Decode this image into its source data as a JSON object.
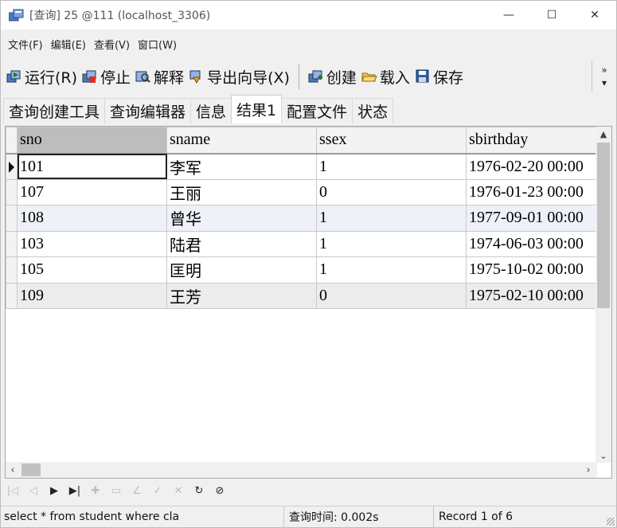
{
  "window": {
    "title": "[查询] 25 @111 (localhost_3306)",
    "controls": {
      "minimize": "—",
      "maximize": "☐",
      "close": "✕"
    }
  },
  "menu": [
    "文件(F)",
    "编辑(E)",
    "查看(V)",
    "窗口(W)"
  ],
  "toolbar": {
    "run": "运行(R)",
    "stop": "停止",
    "explain": "解释",
    "export": "导出向导(X)",
    "create": "创建",
    "load": "载入",
    "save": "保存",
    "overflow": "»"
  },
  "tabs": [
    "查询创建工具",
    "查询编辑器",
    "信息",
    "结果1",
    "配置文件",
    "状态"
  ],
  "active_tab": "结果1",
  "grid": {
    "columns": [
      "sno",
      "sname",
      "ssex",
      "sbirthday"
    ],
    "sorted_column": "sno",
    "rows": [
      [
        "101",
        "李军",
        "1",
        "1976-02-20 00:00"
      ],
      [
        "107",
        "王丽",
        "0",
        "1976-01-23 00:00"
      ],
      [
        "108",
        "曾华",
        "1",
        "1977-09-01 00:00"
      ],
      [
        "103",
        "陆君",
        "1",
        "1974-06-03 00:00"
      ],
      [
        "105",
        "匡明",
        "1",
        "1975-10-02 00:00"
      ],
      [
        "109",
        "王芳",
        "0",
        "1975-02-10 00:00"
      ]
    ],
    "current_row": 1
  },
  "navigator": {
    "buttons": [
      {
        "name": "first-record-icon",
        "glyph": "|◁",
        "enabled": false
      },
      {
        "name": "prior-record-icon",
        "glyph": "◁",
        "enabled": false
      },
      {
        "name": "next-record-icon",
        "glyph": "▶",
        "enabled": true
      },
      {
        "name": "last-record-icon",
        "glyph": "▶|",
        "enabled": true
      },
      {
        "name": "insert-record-icon",
        "glyph": "✚",
        "enabled": false
      },
      {
        "name": "delete-record-icon",
        "glyph": "▭",
        "enabled": false
      },
      {
        "name": "edit-record-icon",
        "glyph": "∠",
        "enabled": false
      },
      {
        "name": "post-edit-icon",
        "glyph": "✓",
        "enabled": false
      },
      {
        "name": "cancel-edit-icon",
        "glyph": "✕",
        "enabled": false
      },
      {
        "name": "refresh-icon",
        "glyph": "↻",
        "enabled": true
      },
      {
        "name": "stop-icon",
        "glyph": "⊘",
        "enabled": true
      }
    ]
  },
  "status": {
    "sql": "select * from student where cla",
    "query_time": "查询时间: 0.002s",
    "record": "Record 1 of 6"
  }
}
